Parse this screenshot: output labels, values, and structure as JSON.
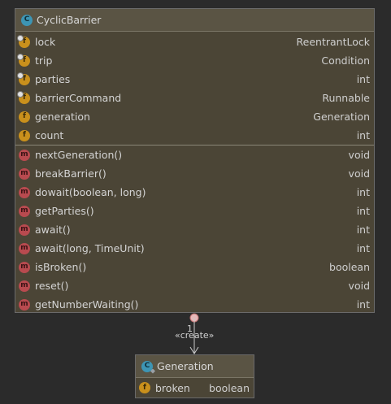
{
  "main_class": {
    "icon": "class-icon",
    "title": "CyclicBarrier",
    "fields": [
      {
        "name": "lock",
        "type": "ReentrantLock",
        "icon": "field-icon",
        "final": true
      },
      {
        "name": "trip",
        "type": "Condition",
        "icon": "field-icon",
        "final": true
      },
      {
        "name": "parties",
        "type": "int",
        "icon": "field-icon",
        "final": true
      },
      {
        "name": "barrierCommand",
        "type": "Runnable",
        "icon": "field-icon",
        "final": true
      },
      {
        "name": "generation",
        "type": "Generation",
        "icon": "field-icon",
        "final": false
      },
      {
        "name": "count",
        "type": "int",
        "icon": "field-icon",
        "final": false
      }
    ],
    "methods": [
      {
        "name": "nextGeneration()",
        "type": "void",
        "icon": "method-icon"
      },
      {
        "name": "breakBarrier()",
        "type": "void",
        "icon": "method-icon"
      },
      {
        "name": "dowait(boolean, long)",
        "type": "int",
        "icon": "method-icon"
      },
      {
        "name": "getParties()",
        "type": "int",
        "icon": "method-icon"
      },
      {
        "name": "await()",
        "type": "int",
        "icon": "method-icon"
      },
      {
        "name": "await(long, TimeUnit)",
        "type": "int",
        "icon": "method-icon"
      },
      {
        "name": "isBroken()",
        "type": "boolean",
        "icon": "method-icon"
      },
      {
        "name": "reset()",
        "type": "void",
        "icon": "method-icon"
      },
      {
        "name": "getNumberWaiting()",
        "type": "int",
        "icon": "method-icon"
      }
    ]
  },
  "inner_class": {
    "icon": "class-icon",
    "title": "Generation",
    "fields": [
      {
        "name": "broken",
        "type": "boolean",
        "icon": "field-icon",
        "final": false
      }
    ]
  },
  "connector": {
    "multiplicity": "1",
    "stereotype": "«create»"
  },
  "colors": {
    "background": "#2b2b2b",
    "box": "#4b4536",
    "field_icon": "#c9901c",
    "method_icon": "#b84a4f",
    "class_icon": "#3d95b4"
  }
}
